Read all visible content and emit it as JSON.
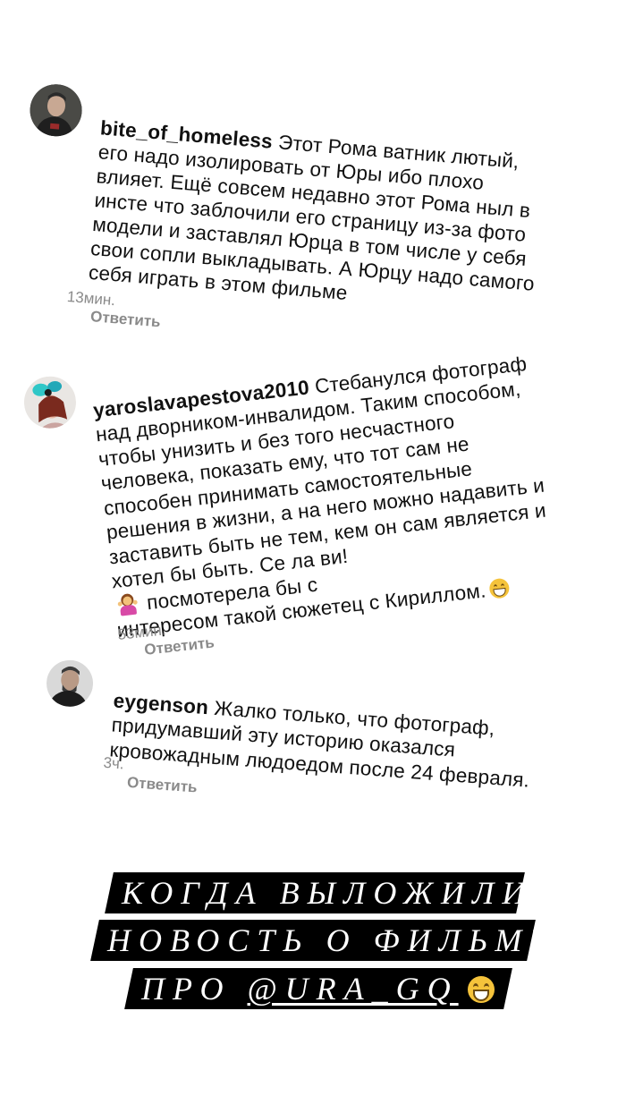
{
  "comments": [
    {
      "username": "bite_of_homeless",
      "text": " Этот Рома ватник лютый,\nего надо изолировать от Юры ибо плохо\nвлияет. Ещё совсем недавно этот Рома ныл в\nинсте что заблочили его страницу из-за фото\nмодели и заставлял Юрца в том числе у себя\nсвои сопли выкладывать. А Юрцу надо самого\nсебя играть в этом фильме",
      "time": "13мин.",
      "reply_label": "Ответить",
      "avatar_icon": "profile-photo"
    },
    {
      "username": "yaroslavapestova2010",
      "text_part1": " Стебанулся фотограф\nнад дворником-инвалидом. Таким способом,\nчтобы унизить и без того несчастного\nчеловека, показать ему, что тот сам не\nспособен принимать самостоятельные\nрешения в жизни, а на него можно надавить и\nзаставить быть не тем, кем он сам является и\nхотел бы быть. Се ла ви!",
      "text_part2": " посмотерела бы с\nинтересом такой сюжетец с Кириллом.",
      "emoji1": "person-shrugging-emoji",
      "emoji2": "grinning-face-emoji",
      "time": "53мин.",
      "reply_label": "Ответить",
      "avatar_icon": "profile-photo"
    },
    {
      "username": "eygenson",
      "text": " Жалко только, что фотограф,\nпридумавший эту историю оказался\nкровожадным людоедом после 24 февраля.",
      "time": "3ч.",
      "reply_label": "Ответить",
      "avatar_icon": "profile-photo"
    }
  ],
  "banner": {
    "line1": "КОГДА ВЫЛОЖИЛИ",
    "line2": "НОВОСТЬ О ФИЛЬМЕ",
    "line3_prefix": "ПРО ",
    "line3_mention": "@URA_GQ",
    "emoji": "grinning-face-emoji"
  }
}
